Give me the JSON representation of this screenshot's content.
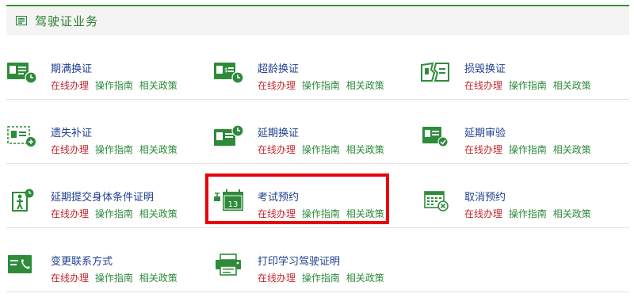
{
  "panel": {
    "title": "驾驶证业务",
    "icon": "list-card-icon"
  },
  "theme": {
    "primary_green": "#2e8b3a",
    "title_blue": "#1f3f8f",
    "online_red": "#c0272d",
    "highlight_red": "#e8000a"
  },
  "services": [
    {
      "title": "期满换证",
      "icon": "id-card-clock-icon",
      "links": {
        "online": "在线办理",
        "guide": "操作指南",
        "policy": "相关政策"
      }
    },
    {
      "title": "超龄换证",
      "icon": "elderly-card-icon",
      "links": {
        "online": "在线办理",
        "guide": "操作指南",
        "policy": "相关政策"
      }
    },
    {
      "title": "损毁换证",
      "icon": "damaged-card-icon",
      "links": {
        "online": "在线办理",
        "guide": "操作指南",
        "policy": "相关政策"
      }
    },
    {
      "title": "遗失补证",
      "icon": "lost-card-icon",
      "links": {
        "online": "在线办理",
        "guide": "操作指南",
        "policy": "相关政策"
      }
    },
    {
      "title": "延期换证",
      "icon": "card-clock-icon",
      "links": {
        "online": "在线办理",
        "guide": "操作指南",
        "policy": "相关政策"
      }
    },
    {
      "title": "延期审验",
      "icon": "card-review-icon",
      "links": {
        "online": "在线办理",
        "guide": "操作指南",
        "policy": "相关政策"
      }
    },
    {
      "title": "延期提交身体条件证明",
      "icon": "person-clock-icon",
      "links": {
        "online": "在线办理",
        "guide": "操作指南",
        "policy": "相关政策"
      }
    },
    {
      "title": "考试预约",
      "icon": "calendar-13-icon",
      "calendar_day": "13",
      "links": {
        "online": "在线办理",
        "guide": "操作指南",
        "policy": "相关政策"
      }
    },
    {
      "title": "取消预约",
      "icon": "calendar-cancel-icon",
      "links": {
        "online": "在线办理",
        "guide": "操作指南",
        "policy": "相关政策"
      }
    },
    {
      "title": "变更联系方式",
      "icon": "phone-card-icon",
      "links": {
        "online": "在线办理",
        "guide": "操作指南",
        "policy": "相关政策"
      }
    },
    {
      "title": "打印学习驾驶证明",
      "icon": "printer-icon",
      "links": {
        "online": "在线办理",
        "guide": "操作指南",
        "policy": "相关政策"
      }
    }
  ]
}
